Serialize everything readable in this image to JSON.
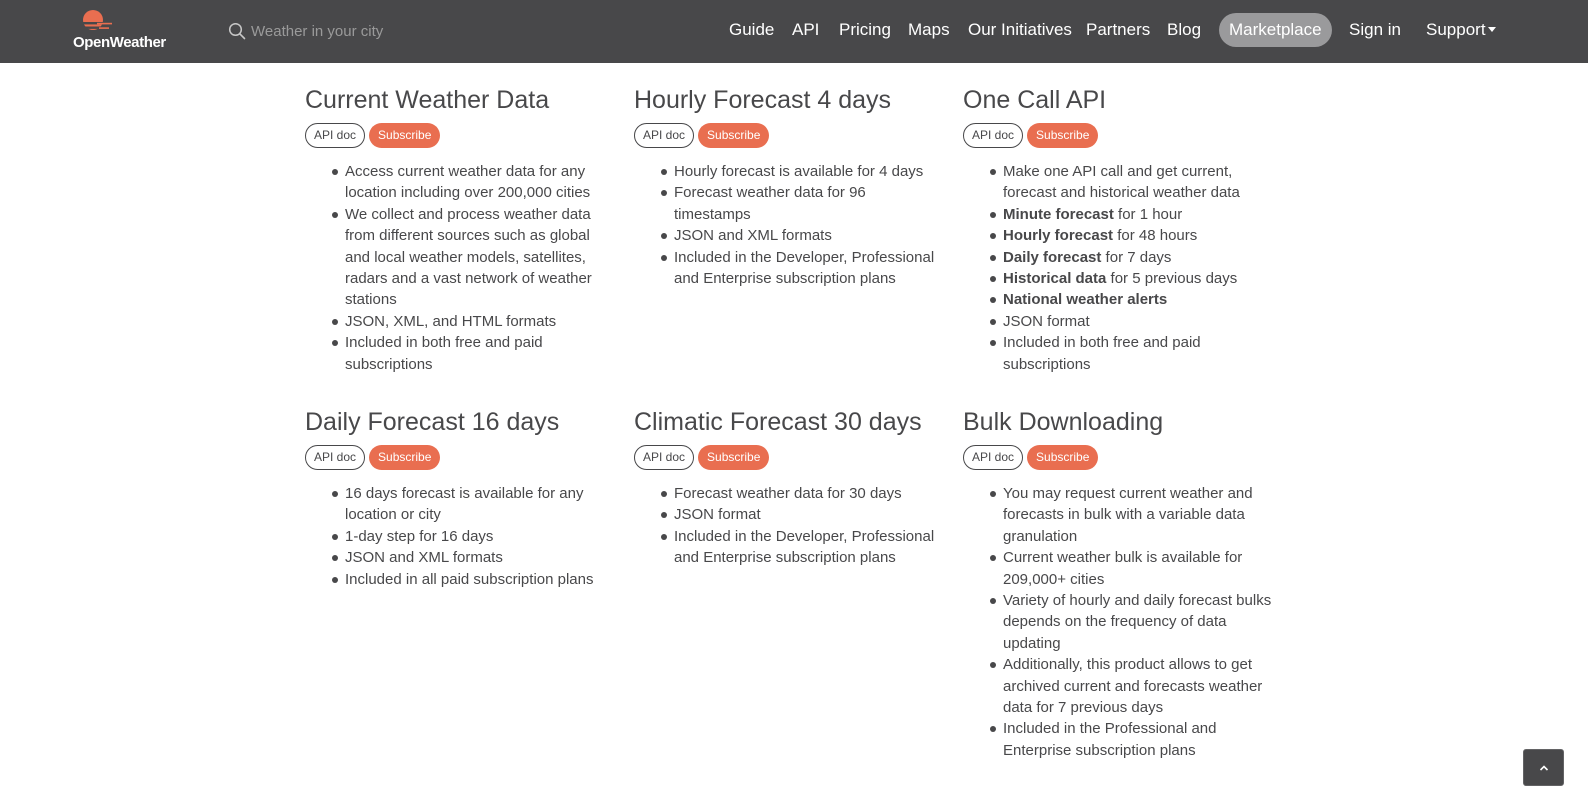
{
  "header": {
    "logo_text": "OpenWeather",
    "search_placeholder": "Weather in your city",
    "nav": {
      "guide": "Guide",
      "api": "API",
      "pricing": "Pricing",
      "maps": "Maps",
      "initiatives": "Our Initiatives",
      "partners": "Partners",
      "blog": "Blog",
      "marketplace": "Marketplace",
      "signin": "Sign in",
      "support": "Support"
    },
    "colors": {
      "bar": "#48484a",
      "brand": "#e96e50",
      "active_pill": "#9a9a9c"
    }
  },
  "buttons": {
    "api_doc": "API doc",
    "subscribe": "Subscribe"
  },
  "products": [
    {
      "title": "Current Weather Data",
      "items": [
        {
          "text": "Access current weather data for any location including over 200,000 cities"
        },
        {
          "text": "We collect and process weather data from different sources such as global and local weather models, satellites, radars and a vast network of weather stations"
        },
        {
          "text": "JSON, XML, and HTML formats"
        },
        {
          "text": "Included in both free and paid subscriptions"
        }
      ]
    },
    {
      "title": "Hourly Forecast 4 days",
      "items": [
        {
          "text": "Hourly forecast is available for 4 days"
        },
        {
          "text": "Forecast weather data for 96 timestamps"
        },
        {
          "text": "JSON and XML formats"
        },
        {
          "text": "Included in the Developer, Professional and Enterprise subscription plans"
        }
      ]
    },
    {
      "title": "One Call API",
      "items": [
        {
          "text": "Make one API call and get current, forecast and historical weather data"
        },
        {
          "bold": "Minute forecast",
          "text": " for 1 hour"
        },
        {
          "bold": "Hourly forecast",
          "text": " for 48 hours"
        },
        {
          "bold": "Daily forecast",
          "text": " for 7 days"
        },
        {
          "bold": "Historical data",
          "text": " for 5 previous days"
        },
        {
          "bold": "National weather alerts",
          "text": ""
        },
        {
          "text": "JSON format"
        },
        {
          "text": "Included in both free and paid subscriptions"
        }
      ]
    },
    {
      "title": "Daily Forecast 16 days",
      "items": [
        {
          "text": "16 days forecast is available for any location or city"
        },
        {
          "text": "1-day step for 16 days"
        },
        {
          "text": "JSON and XML formats"
        },
        {
          "text": "Included in all paid subscription plans"
        }
      ]
    },
    {
      "title": "Climatic Forecast 30 days",
      "items": [
        {
          "text": "Forecast weather data for 30 days"
        },
        {
          "text": "JSON format"
        },
        {
          "text": "Included in the Developer, Professional and Enterprise subscription plans"
        }
      ]
    },
    {
      "title": "Bulk Downloading",
      "items": [
        {
          "text": "You may request current weather and forecasts in bulk with a variable data granulation"
        },
        {
          "text": "Current weather bulk is available for 209,000+ cities"
        },
        {
          "text": "Variety of hourly and daily forecast bulks depends on the frequency of data updating"
        },
        {
          "text": "Additionally, this product allows to get archived current and forecasts weather data for 7 previous days"
        },
        {
          "text": "Included in the Professional and Enterprise subscription plans"
        }
      ]
    }
  ],
  "scroll_top_icon": "chevron-up-icon"
}
